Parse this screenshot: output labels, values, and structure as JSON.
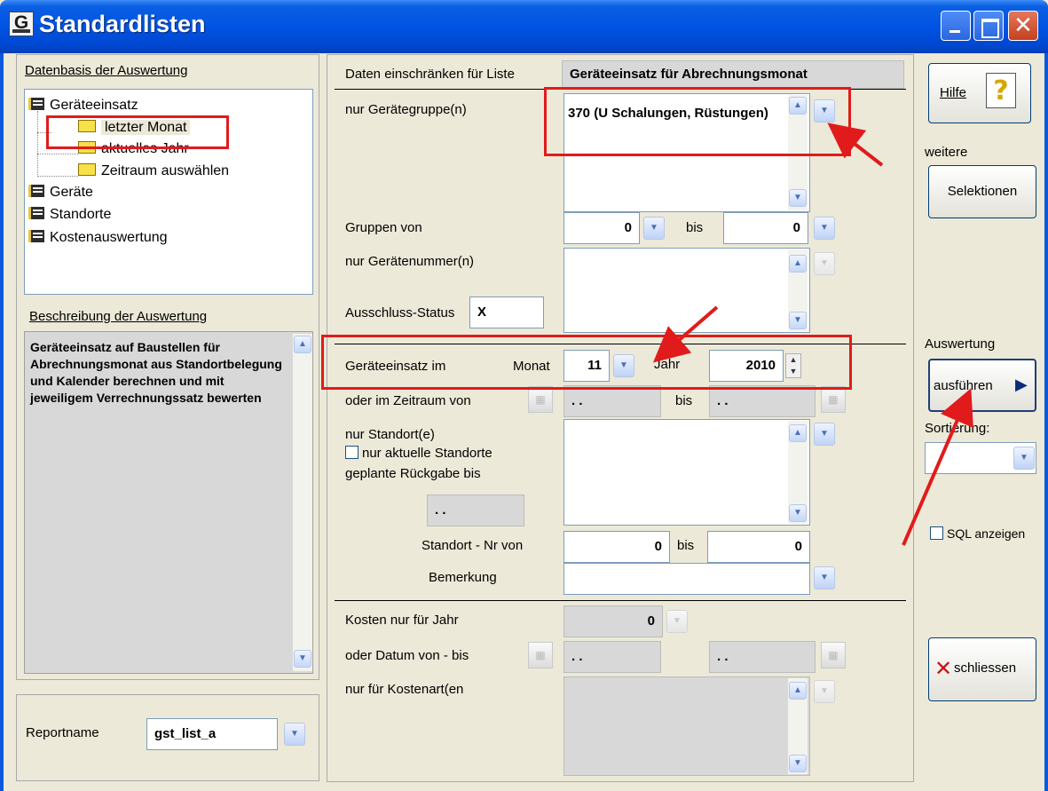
{
  "window": {
    "title": "Standardlisten",
    "app_icon": "G"
  },
  "left": {
    "datenbasis_label": "Datenbasis der Auswertung",
    "tree": [
      {
        "label": "Geräteeinsatz",
        "icon": "book-icon"
      },
      {
        "label": "letzter Monat",
        "icon": "folder-icon",
        "selected": true
      },
      {
        "label": "aktuelles Jahr",
        "icon": "folder-icon"
      },
      {
        "label": "Zeitraum auswählen",
        "icon": "folder-icon"
      },
      {
        "label": "Geräte",
        "icon": "book-icon"
      },
      {
        "label": "Standorte",
        "icon": "book-icon"
      },
      {
        "label": "Kostenauswertung",
        "icon": "book-icon"
      }
    ],
    "beschreibung_label": "Beschreibung der Auswertung",
    "description": "Geräteeinsatz auf Baustellen für Abrechnungsmonat aus Standortbelegung und Kalender berechnen und mit jeweiligem Verrechnungssatz bewerten",
    "reportname_label": "Reportname",
    "reportname_value": "gst_list_a"
  },
  "main": {
    "header_label": "Daten einschränken für Liste",
    "header_value": "Geräteeinsatz für Abrechnungsmonat",
    "geraetegruppe_label": "nur Gerätegruppe(n)",
    "geraetegruppe_value": "370 (U Schalungen, Rüstungen)",
    "gruppen_von_label": "Gruppen von",
    "gruppen_von_value": "0",
    "bis_label": "bis",
    "gruppen_bis_value": "0",
    "geraetenummer_label": "nur Gerätenummer(n)",
    "ausschluss_label": "Ausschluss-Status",
    "ausschluss_value": "X",
    "einsatz_label": "Geräteeinsatz im",
    "monat_label": "Monat",
    "monat_value": "11",
    "jahr_label": "Jahr",
    "jahr_value": "2010",
    "zeitraum_label": "oder im Zeitraum von",
    "date_empty": ". .",
    "standort_label": "nur Standort(e)",
    "aktuelle_standorte_label": "nur aktuelle Standorte",
    "rueckgabe_label": "geplante Rückgabe bis",
    "standort_nr_label": "Standort - Nr von",
    "standort_nr_von": "0",
    "standort_nr_bis": "0",
    "bemerkung_label": "Bemerkung",
    "kosten_jahr_label": "Kosten nur für Jahr",
    "kosten_jahr_value": "0",
    "datum_label": "oder Datum von - bis",
    "kostenart_label": "nur für Kostenart(en"
  },
  "right": {
    "hilfe_label": "Hilfe",
    "weitere_label": "weitere",
    "selektionen_label": "Selektionen",
    "auswertung_label": "Auswertung",
    "ausfuehren_label": "ausführen",
    "sortierung_label": "Sortierung:",
    "sql_label": "SQL anzeigen",
    "schliessen_label": "schliessen"
  },
  "colors": {
    "title_bar": "#0054e3",
    "annotation": "#e11b1b",
    "background": "#ece9d8"
  }
}
